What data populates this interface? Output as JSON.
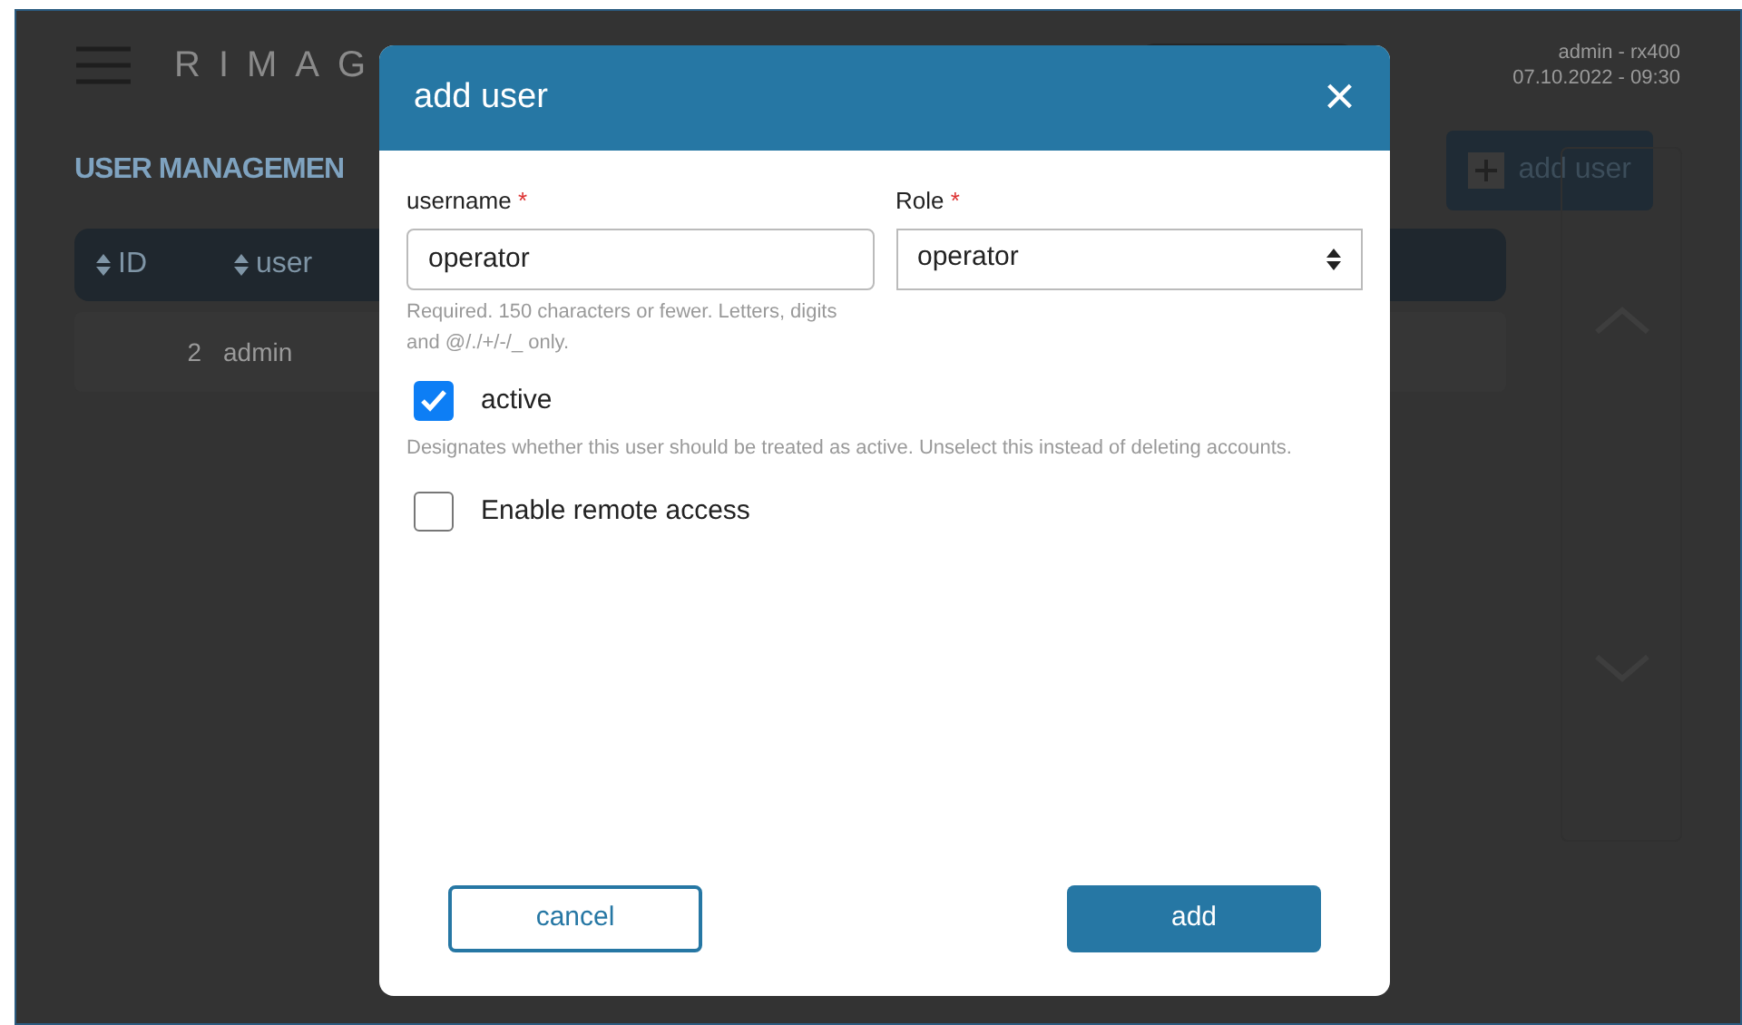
{
  "header": {
    "logo": "RIMAG",
    "user": "admin - rx400",
    "datetime": "07.10.2022 - 09:30"
  },
  "page": {
    "title": "USER MANAGEMEN",
    "add_button": "add user"
  },
  "table": {
    "columns": [
      "ID",
      "user"
    ],
    "rows": [
      {
        "id": "2",
        "user": "admin"
      }
    ]
  },
  "dialog": {
    "title": "add user",
    "close": "×",
    "fields": [
      {
        "kind": "text",
        "label": "username",
        "required_mark": "*",
        "value": "operator",
        "help": "Required. 150 characters or fewer. Letters, digits and @/./+/-/_ only."
      },
      {
        "kind": "select",
        "label": "Role",
        "required_mark": "*",
        "value": "operator"
      }
    ],
    "checkboxes": [
      {
        "label": "active",
        "checked": true,
        "help": "Designates whether this user should be treated as active. Unselect this instead of deleting accounts."
      },
      {
        "label": "Enable remote access",
        "checked": false
      }
    ],
    "buttons": [
      {
        "kind": "secondary",
        "label": "cancel"
      },
      {
        "kind": "primary",
        "label": "add"
      }
    ]
  }
}
